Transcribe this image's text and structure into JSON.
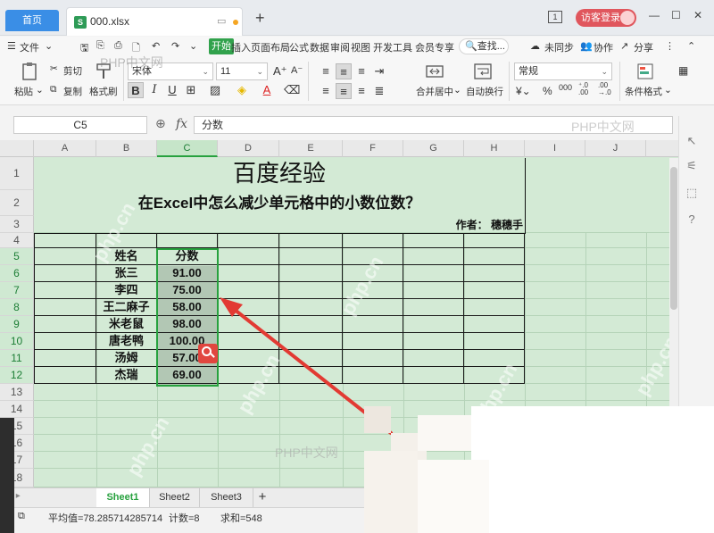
{
  "titlebar": {
    "home_tab": "首页",
    "file_tab": "000.xlsx",
    "login": "访客登录",
    "badge": "1"
  },
  "menu": {
    "file": "文件",
    "items": [
      "开始",
      "插入",
      "页面布局",
      "公式",
      "数据",
      "审阅",
      "视图",
      "开发工具",
      "会员专享"
    ],
    "active": "开始",
    "search": "查找...",
    "sync": "未同步",
    "collab": "协作",
    "share": "分享"
  },
  "ribbon": {
    "cut": "剪切",
    "copy": "复制",
    "paste": "粘贴",
    "format_painter": "格式刷",
    "font": "宋体",
    "font_size": "11",
    "merge_center": "合并居中",
    "wrap": "自动换行",
    "number_format": "常规",
    "cond_format": "条件格式"
  },
  "formula_bar": {
    "cell_ref": "C5",
    "fx": "fx",
    "content": "分数"
  },
  "grid": {
    "columns": [
      "A",
      "B",
      "C",
      "D",
      "E",
      "F",
      "G",
      "H",
      "I",
      "J"
    ],
    "selected_column": "C",
    "rows": [
      "1",
      "2",
      "3",
      "4",
      "5",
      "6",
      "7",
      "8",
      "9",
      "10",
      "11",
      "12",
      "13",
      "14",
      "15",
      "16",
      "17",
      "18"
    ],
    "title": "百度经验",
    "subtitle": "在Excel中怎么减少单元格中的小数位数？",
    "author": "作者：  穗穗手",
    "table_header": {
      "name": "姓名",
      "score": "分数"
    },
    "table_rows": [
      {
        "name": "张三",
        "score": "91.00"
      },
      {
        "name": "李四",
        "score": "75.00"
      },
      {
        "name": "王二麻子",
        "score": "58.00"
      },
      {
        "name": "米老鼠",
        "score": "98.00"
      },
      {
        "name": "唐老鸭",
        "score": "100.00"
      },
      {
        "name": "汤姆",
        "score": "57.00"
      },
      {
        "name": "杰瑞",
        "score": "69.00"
      }
    ]
  },
  "sheets": {
    "tabs": [
      "Sheet1",
      "Sheet2",
      "Sheet3"
    ],
    "active": "Sheet1",
    "add": "+"
  },
  "status": {
    "average": "平均值=78.285714285714",
    "count": "计数=8",
    "sum": "求和=548"
  },
  "watermarks": {
    "site": "PHP中文网",
    "domain": "php.cn"
  },
  "colors": {
    "grid_fill": "#d3ead5",
    "selection": "#27a13e",
    "arrow": "#e23a33",
    "accent_tab": "#3a8ee6"
  }
}
